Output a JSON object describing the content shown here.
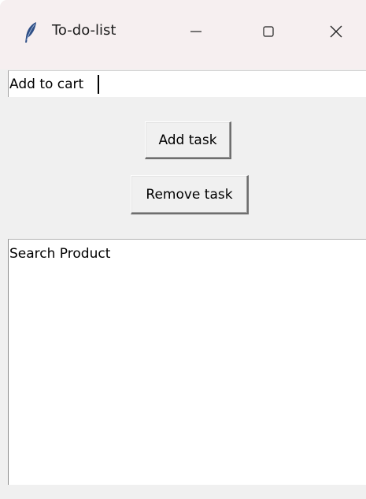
{
  "window": {
    "title": "To-do-list",
    "controls": {
      "minimize": "minimize",
      "maximize": "maximize",
      "close": "close"
    },
    "icon": "feather-icon"
  },
  "entry": {
    "value": "Add to cart"
  },
  "buttons": {
    "add_label": "Add task",
    "remove_label": "Remove task"
  },
  "tasks": [
    "Search Product"
  ],
  "colors": {
    "titlebar": "#f6eff0",
    "window_bg": "#f0f0f0",
    "field_bg": "#ffffff",
    "feather_blue": "#2f4f86"
  }
}
